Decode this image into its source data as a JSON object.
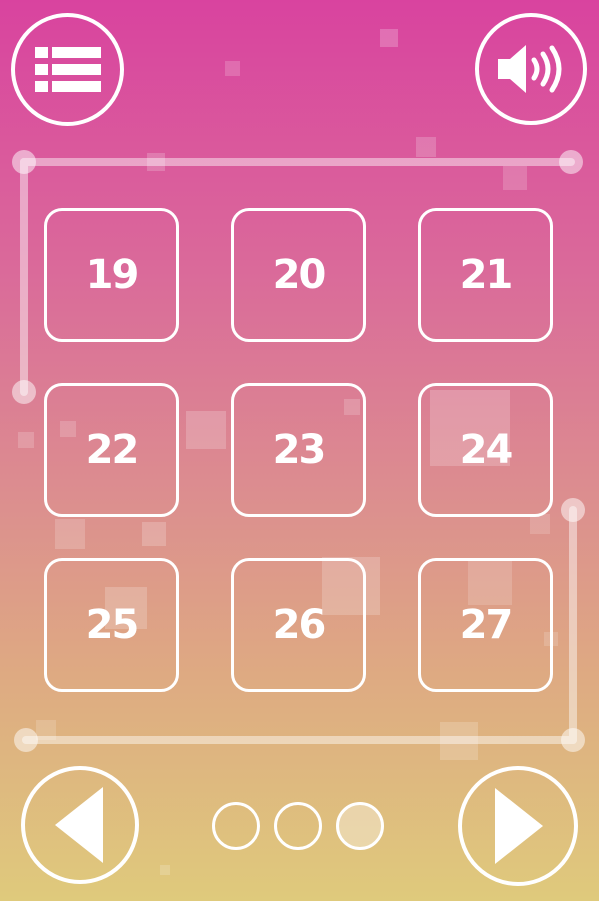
{
  "header": {
    "menu_icon": "list-icon",
    "sound_icon": "speaker-icon"
  },
  "levels": [
    "19",
    "20",
    "21",
    "22",
    "23",
    "24",
    "25",
    "26",
    "27"
  ],
  "pagination": {
    "pages": 3,
    "current": 3
  },
  "footer": {
    "prev_icon": "triangle-left-icon",
    "next_icon": "triangle-right-icon"
  },
  "colors": {
    "gradient_top": "#d9439f",
    "gradient_bottom": "#dfca7c",
    "stroke": "#ffffff"
  }
}
